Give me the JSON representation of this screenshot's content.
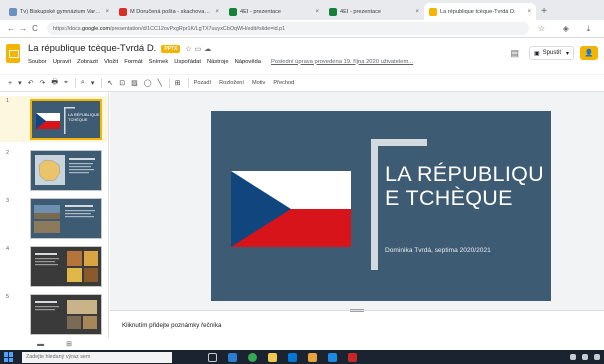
{
  "browser": {
    "tabs": [
      {
        "title": "Tv) Biskupské gymnázium Varnsdorf",
        "favicon_color": "#6b8fbf",
        "active": false
      },
      {
        "title": "M Doručená pošta - skachova@bi...",
        "favicon_color": "#d93025",
        "active": false
      },
      {
        "title": "4EI - prezentace",
        "favicon_color": "#188038",
        "active": false
      },
      {
        "title": "4EI - prezentace",
        "favicon_color": "#188038",
        "active": false
      },
      {
        "title": "La république tcèque-Tvrdá D.",
        "favicon_color": "#f4b400",
        "active": true
      }
    ],
    "close_glyph": "×",
    "new_tab_glyph": "+",
    "back_glyph": "←",
    "forward_glyph": "→",
    "reload_glyph": "C",
    "url_prefix": "https://docs.",
    "url_domain": "google.com",
    "url_suffix": "/presentation/d/1CC12ovPxgRpr1K/LgTX7uuyxCbOqWH/edit#slide=id.p1",
    "shield_glyph": "◯",
    "lock_glyph": "🔒",
    "star_glyph": "☆",
    "shield2_glyph": "◈",
    "download_glyph": "⤓"
  },
  "app": {
    "doc_title": "La république tcèque-Tvrdá D.",
    "file_badge": "PPTX",
    "star_icon": "☆",
    "folder_icon": "▭",
    "cloud_icon": "☁",
    "menu": [
      "Soubor",
      "Upravit",
      "Zobrazit",
      "Vložit",
      "Formát",
      "Snímek",
      "Uspořádat",
      "Nástroje",
      "Nápověda"
    ],
    "last_edit": "Poslední úprava provedena 19. října 2020 uživatelem...",
    "comment_icon": "▤",
    "present_label": "Spustit",
    "present_icon": "▣",
    "present_caret": "▾",
    "share_icon": "👤"
  },
  "toolbar": {
    "plus": "+",
    "caret": "▾",
    "undo": "↶",
    "redo": "↷",
    "print": "🖶",
    "paint": "⌖",
    "zoom": "⌕",
    "select": "↖",
    "textbox": "⊡",
    "image": "▨",
    "shape": "◯",
    "line": "╲",
    "comment": "⊞",
    "background_label": "Pozadí",
    "layout_label": "Rozložení",
    "theme_label": "Motiv",
    "transition_label": "Přechod"
  },
  "slides": [
    {
      "number": "1",
      "selected": true,
      "kind": "title"
    },
    {
      "number": "2",
      "selected": false,
      "kind": "map"
    },
    {
      "number": "3",
      "selected": false,
      "kind": "photo"
    },
    {
      "number": "4",
      "selected": false,
      "kind": "food"
    },
    {
      "number": "5",
      "selected": false,
      "kind": "dark"
    }
  ],
  "thumbnail_text": {
    "slide1_title": "LA RÉPUBLIQUE TCHÈQUE"
  },
  "slide": {
    "title": "LA RÉPUBLIQU E TCHÈQUE",
    "subtitle": "Dominika Tvrdá, septima 2020/2021",
    "background_color": "#3e5b74",
    "flag_colors": {
      "white": "#ffffff",
      "red": "#d7141a",
      "blue": "#11457e"
    }
  },
  "notes": {
    "placeholder": "Kliknutím přidejte poznámky řečníka"
  },
  "view": {
    "filmstrip_icon": "▬",
    "grid_icon": "⊞"
  },
  "taskbar": {
    "search_placeholder": "Zadejte hledaný výraz sem"
  }
}
